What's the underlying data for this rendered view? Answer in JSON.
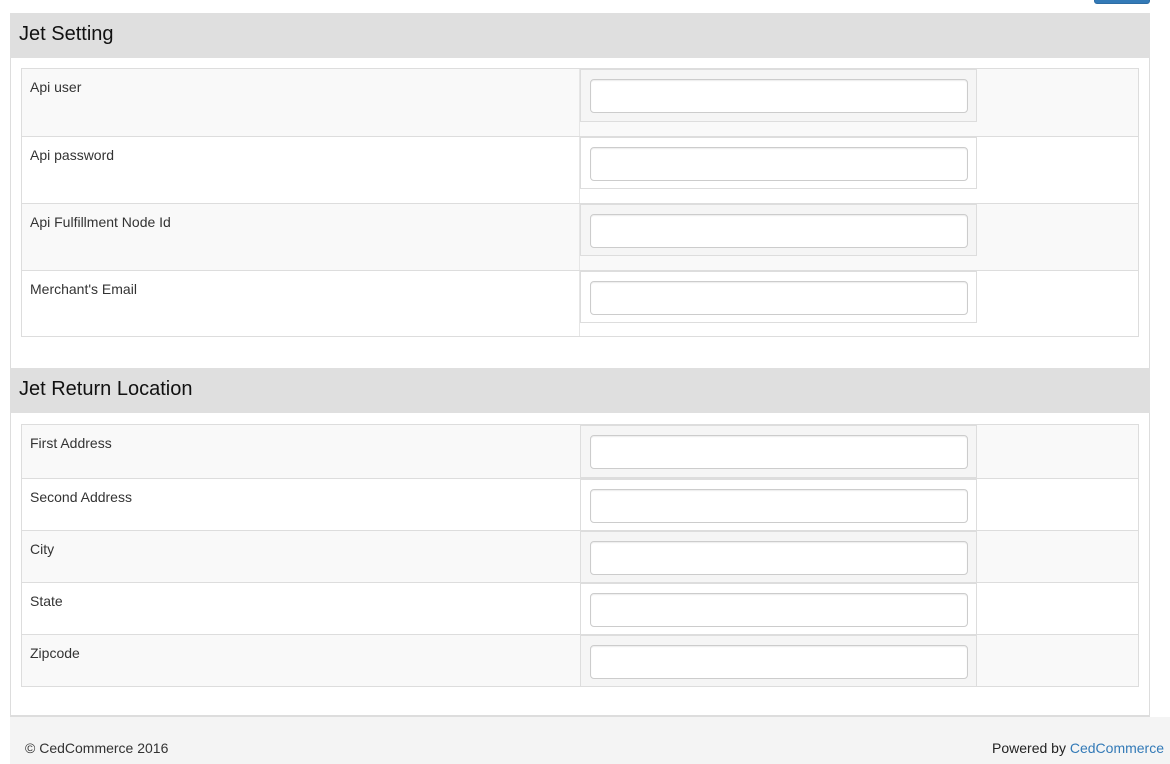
{
  "sections": [
    {
      "title": "Jet Setting",
      "fields": [
        {
          "label": "Api user",
          "value": ""
        },
        {
          "label": "Api password",
          "value": ""
        },
        {
          "label": "Api Fulfillment Node Id",
          "value": ""
        },
        {
          "label": "Merchant's Email",
          "value": ""
        }
      ]
    },
    {
      "title": "Jet Return Location",
      "fields": [
        {
          "label": "First Address",
          "value": ""
        },
        {
          "label": "Second Address",
          "value": ""
        },
        {
          "label": "City",
          "value": ""
        },
        {
          "label": "State",
          "value": ""
        },
        {
          "label": "Zipcode",
          "value": ""
        }
      ]
    }
  ],
  "footer": {
    "copyright": "© CedCommerce 2016",
    "powered_by": "Powered by",
    "brand_link": "CedCommerce"
  },
  "colors": {
    "accent": "#337ab7",
    "header_bg": "#dfdfdf"
  }
}
